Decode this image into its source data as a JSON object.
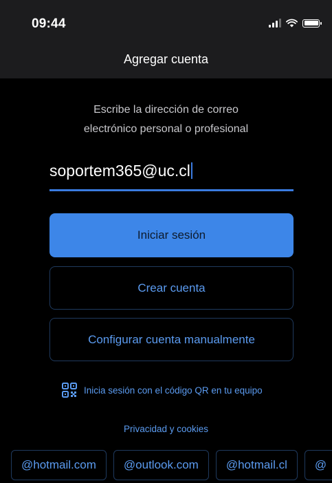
{
  "status_bar": {
    "time": "09:44"
  },
  "header": {
    "title": "Agregar cuenta"
  },
  "instructions": {
    "line1": "Escribe la dirección de correo",
    "line2": "electrónico personal o profesional"
  },
  "email_field": {
    "value": "soportem365@uc.cl"
  },
  "buttons": {
    "sign_in": "Iniciar sesión",
    "create_account": "Crear cuenta",
    "manual_setup": "Configurar cuenta manualmente"
  },
  "qr_login": {
    "label": "Inicia sesión con el código QR en tu equipo"
  },
  "privacy_link": "Privacidad y cookies",
  "domain_suggestions": [
    "@hotmail.com",
    "@outlook.com",
    "@hotmail.cl",
    "@"
  ],
  "colors": {
    "accent": "#3d86e8",
    "link": "#5b9bf0",
    "background": "#000000",
    "header_bg": "#1c1c1e"
  }
}
